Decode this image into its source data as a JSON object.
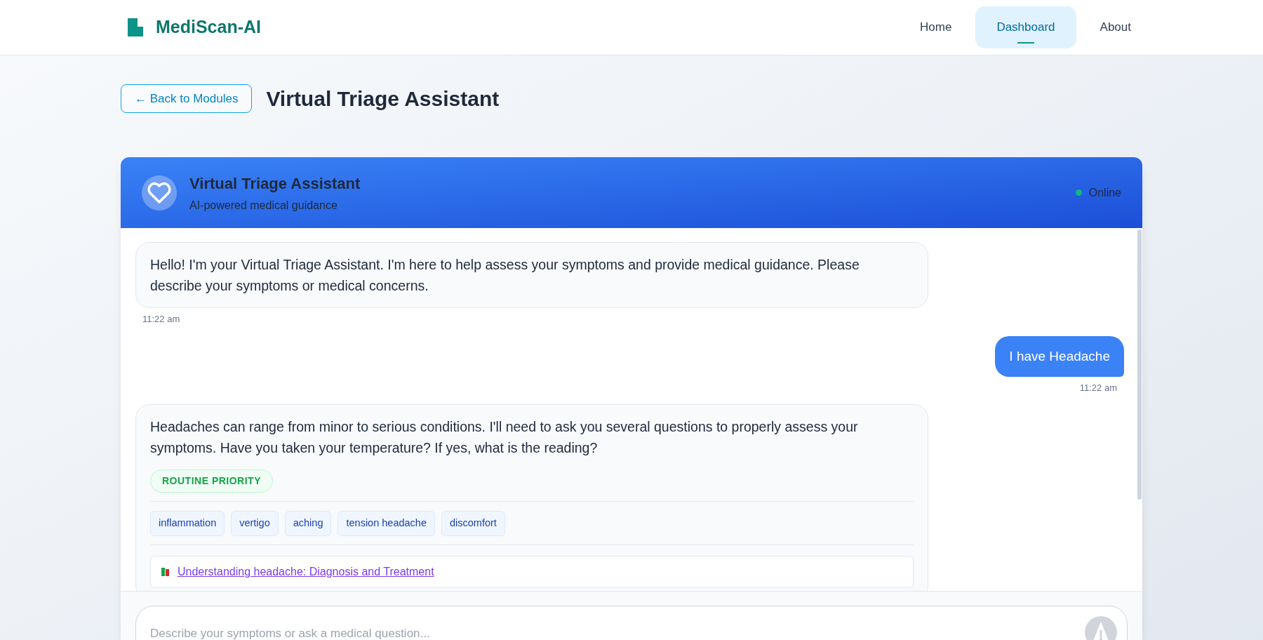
{
  "nav": {
    "brand": "MediScan-AI",
    "links": [
      {
        "label": "Home",
        "selected": false
      },
      {
        "label": "Dashboard",
        "selected": true
      },
      {
        "label": "About",
        "selected": false
      }
    ]
  },
  "page": {
    "back_button": "← Back to Modules",
    "title": "Virtual Triage Assistant"
  },
  "chat": {
    "title": "Virtual Triage Assistant",
    "subtitle": "AI-powered medical guidance",
    "status": {
      "label": "Online",
      "online": true
    },
    "messages": [
      {
        "kind": "bot",
        "text": "Hello! I'm your Virtual Triage Assistant. I'm here to help assess your symptoms and provide medical guidance. Please describe your symptoms or medical concerns.",
        "time": "11:22 am"
      },
      {
        "kind": "user",
        "text": "I have Headache",
        "time": "11:22 am"
      },
      {
        "kind": "bot",
        "text": "Headaches can range from minor to serious conditions. I'll need to ask you several questions to properly assess your symptoms. Have you taken your temperature? If yes, what is the reading?",
        "priority": {
          "label": "ROUTINE PRIORITY",
          "kind": "routine"
        },
        "tags": [
          "inflammation",
          "vertigo",
          "aching",
          "tension headache",
          "discomfort"
        ],
        "resource": "Understanding headache: Diagnosis and Treatment"
      }
    ],
    "input": {
      "placeholder": "Describe your symptoms or ask a medical question..."
    },
    "send_button": {
      "disabled": true
    }
  }
}
